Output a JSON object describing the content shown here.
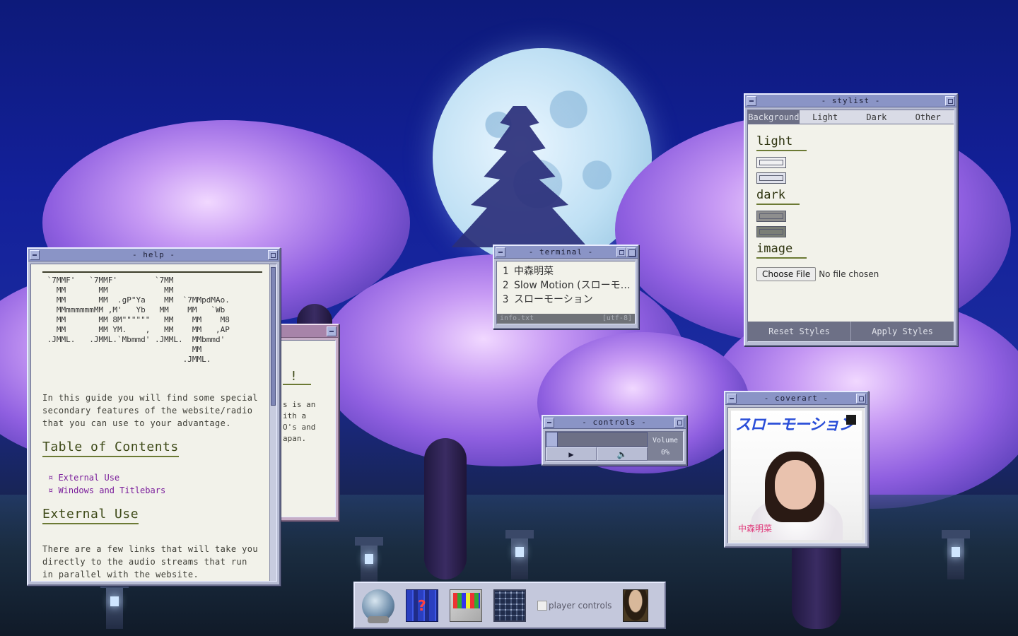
{
  "help": {
    "title": "- help -",
    "ascii": " `7MMF'   `7MMF'        `7MM\n   MM       MM            MM\n   MM       MM  .gP\"Ya    MM  `7MMpdMAo.\n   MMmmmmmmMM ,M'   Yb   MM    MM   `Wb\n   MM       MM 8M\"\"\"\"\"\"   MM    MM    M8\n   MM       MM YM.    ,   MM    MM   ,AP\n .JMML.   .JMML.`Mbmmd' .JMML.  MMbmmd'\n                                MM\n                              .JMML.",
    "intro": "In this guide you will find some special secondary features of the website/radio that you can use to your advantage.",
    "toc_heading": "Table of Contents",
    "toc": [
      "External Use",
      "Windows and Titlebars"
    ],
    "section_heading": "External Use",
    "section_text": "There are a few links that will take you directly to the audio streams that run in parallel with the website."
  },
  "behind": {
    "big": "!",
    "text": "s is an\nith a\nO's and\napan."
  },
  "terminal": {
    "title": "- terminal -",
    "lines": [
      {
        "num": "1",
        "text": "中森明菜"
      },
      {
        "num": "2",
        "text": "Slow Motion (スローモーション)"
      },
      {
        "num": "3",
        "text": "スローモーション"
      }
    ],
    "file": "info.txt",
    "encoding": "[utf-8]"
  },
  "stylist": {
    "title": "- stylist -",
    "tabs": [
      "Background",
      "Light",
      "Dark",
      "Other"
    ],
    "active_tab": "Background",
    "sections": {
      "light": "light",
      "dark": "dark",
      "image": "image"
    },
    "file_button": "Choose File",
    "file_status": "No file chosen",
    "reset_label": "Reset Styles",
    "apply_label": "Apply Styles"
  },
  "controls": {
    "title": "- controls -",
    "play_icon": "▶",
    "speaker_icon": "🔈",
    "volume_label": "Volume",
    "volume_value": "0%"
  },
  "coverart": {
    "title": "- coverart -",
    "album_title": "スローモーション",
    "artist": "中森明菜"
  },
  "dock": {
    "player_controls_alt": "player controls"
  },
  "colors": {
    "window_face": "#b8bdd4",
    "titlebar": "#8a94c6",
    "heading_olive": "#3e4a18",
    "link_purple": "#7a1d9b",
    "footer_slate": "#6d7086"
  }
}
